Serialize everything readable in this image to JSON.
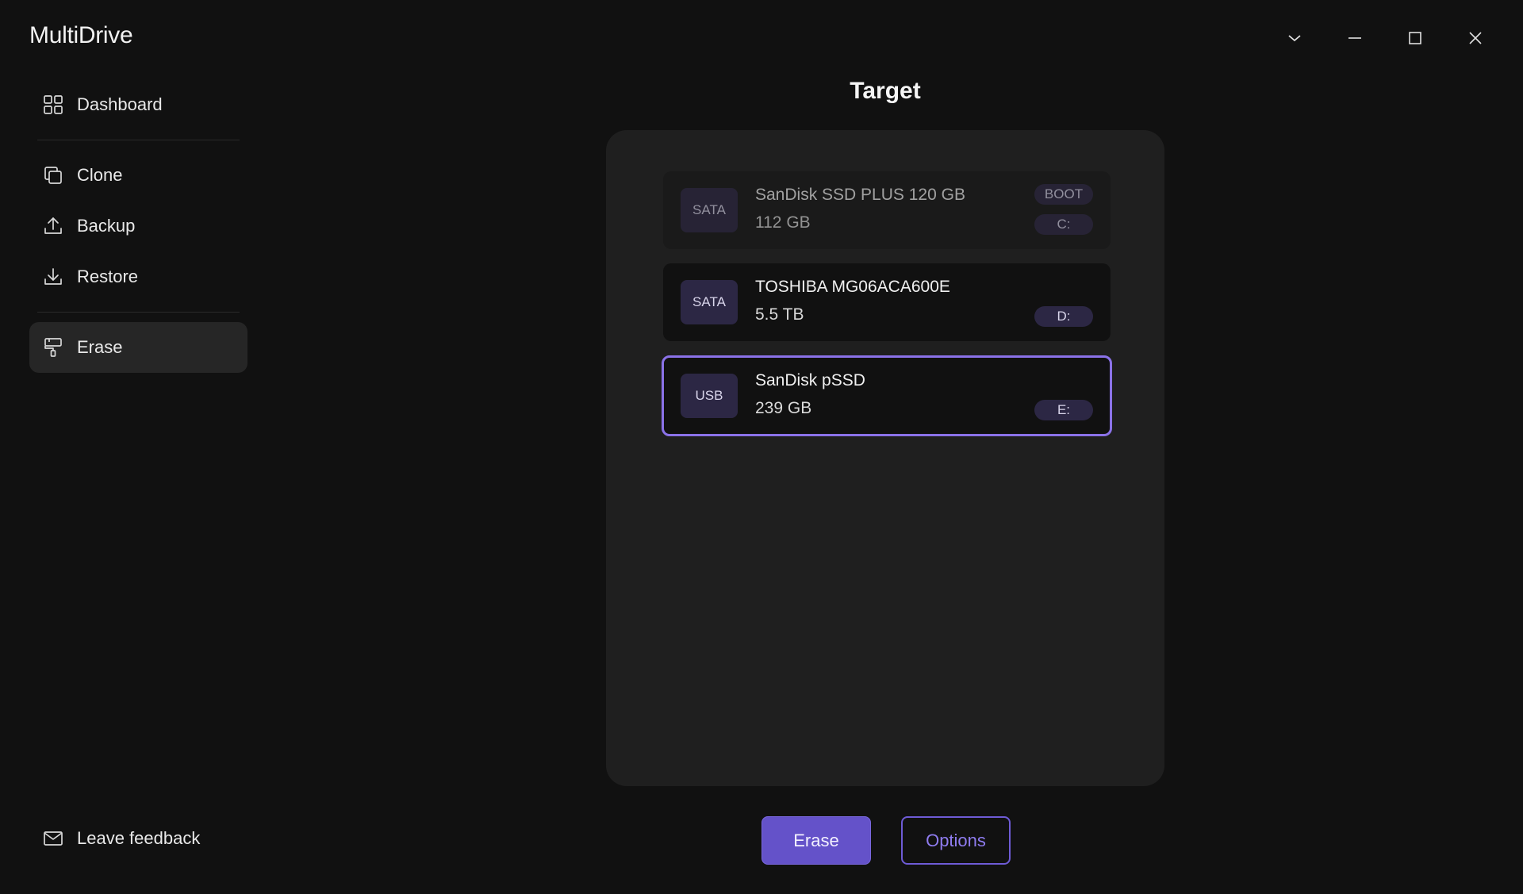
{
  "app": {
    "title": "MultiDrive"
  },
  "window_controls": [
    {
      "name": "chevron-down-icon"
    },
    {
      "name": "minimize-icon"
    },
    {
      "name": "maximize-icon"
    },
    {
      "name": "close-icon"
    }
  ],
  "sidebar": {
    "items": [
      {
        "label": "Dashboard",
        "icon": "grid-icon"
      },
      {
        "label": "Clone",
        "icon": "copy-icon"
      },
      {
        "label": "Backup",
        "icon": "upload-icon"
      },
      {
        "label": "Restore",
        "icon": "download-icon"
      },
      {
        "label": "Erase",
        "icon": "paint-roller-icon",
        "active": true
      }
    ],
    "feedback": {
      "label": "Leave feedback",
      "icon": "mail-icon"
    }
  },
  "main": {
    "title": "Target",
    "drives": [
      {
        "interface": "SATA",
        "name": "SanDisk SSD PLUS 120 GB",
        "size": "112 GB",
        "badges": [
          "BOOT",
          "C:"
        ],
        "disabled": true
      },
      {
        "interface": "SATA",
        "name": "TOSHIBA MG06ACA600E",
        "size": "5.5 TB",
        "badges": [
          "D:"
        ]
      },
      {
        "interface": "USB",
        "name": "SanDisk pSSD",
        "size": "239 GB",
        "badges": [
          "E:"
        ],
        "selected": true
      }
    ],
    "actions": {
      "erase_label": "Erase",
      "options_label": "Options"
    }
  },
  "colors": {
    "background": "#111111",
    "panel": "#1f1f1f",
    "accent": "#6452c9",
    "selected_border": "#8b72e8"
  }
}
